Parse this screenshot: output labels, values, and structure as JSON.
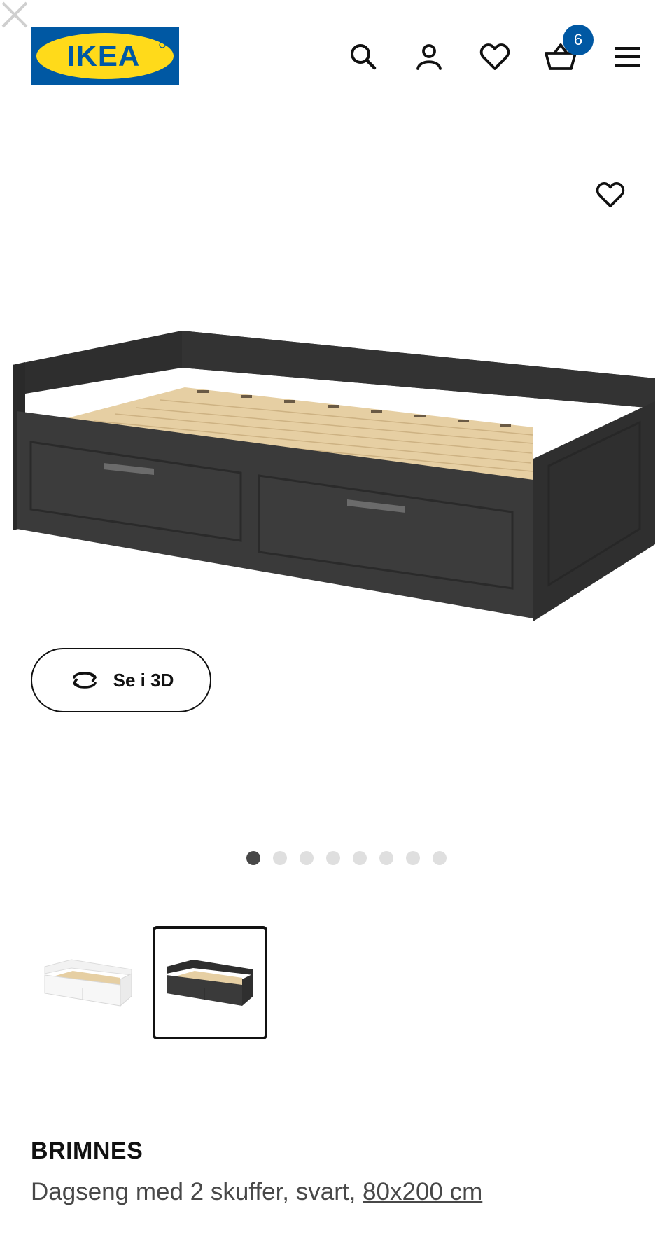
{
  "header": {
    "logo_text": "IKEA",
    "cart_count": "6"
  },
  "product": {
    "view_3d_label": "Se i 3D",
    "carousel": {
      "total": 8,
      "active": 1
    },
    "variants": [
      {
        "color": "white",
        "selected": false
      },
      {
        "color": "black",
        "selected": true
      }
    ],
    "name": "BRIMNES",
    "description": "Dagseng med 2 skuffer, svart, ",
    "size": "80x200 cm"
  },
  "colors": {
    "brand_blue": "#0058a3",
    "logo_yellow": "#ffda1a",
    "bed_frame": "#363636",
    "slats": "#e6cfa3"
  }
}
